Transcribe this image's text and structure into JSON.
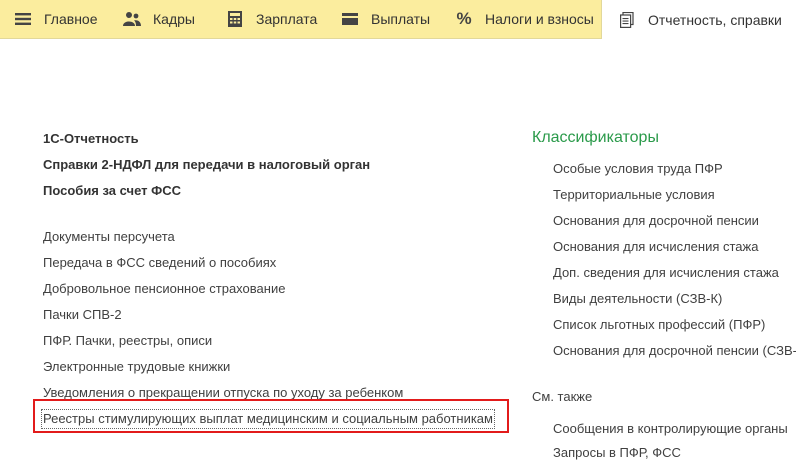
{
  "tabs": [
    {
      "label": "Главное",
      "icon": "menu-icon"
    },
    {
      "label": "Кадры",
      "icon": "people-icon"
    },
    {
      "label": "Зарплата",
      "icon": "calculator-icon"
    },
    {
      "label": "Выплаты",
      "icon": "wallet-icon"
    },
    {
      "label": "Налоги и взносы",
      "icon": "percent-icon"
    },
    {
      "label": "Отчетность, справки",
      "icon": "documents-icon",
      "active": true
    }
  ],
  "left_bold": [
    "1С-Отчетность",
    "Справки 2-НДФЛ для передачи в налоговый орган",
    "Пособия за счет ФСС"
  ],
  "left_links": [
    "Документы персучета",
    "Передача в ФСС сведений о пособиях",
    "Добровольное пенсионное страхование",
    "Пачки СПВ-2",
    "ПФР. Пачки, реестры, описи",
    "Электронные трудовые книжки",
    "Уведомления о прекращении отпуска по уходу за ребенком",
    "Реестры стимулирующих выплат медицинским и социальным работникам"
  ],
  "classifiers": {
    "title": "Классификаторы",
    "items": [
      "Особые условия труда ПФР",
      "Территориальные условия",
      "Основания для досрочной пенсии",
      "Основания для исчисления стажа",
      "Доп. сведения для исчисления стажа",
      "Виды деятельности (СЗВ-К)",
      "Список льготных профессий (ПФР)",
      "Основания для досрочной пенсии (СЗВ-"
    ]
  },
  "see_also": {
    "title": "См. также",
    "items": [
      "Сообщения в контролирующие органы",
      "Запросы в ПФР, ФСС"
    ]
  },
  "colors": {
    "topbar": "#fbed9e",
    "group_title": "#2a9a4a",
    "highlight_frame": "#e21b1b"
  }
}
